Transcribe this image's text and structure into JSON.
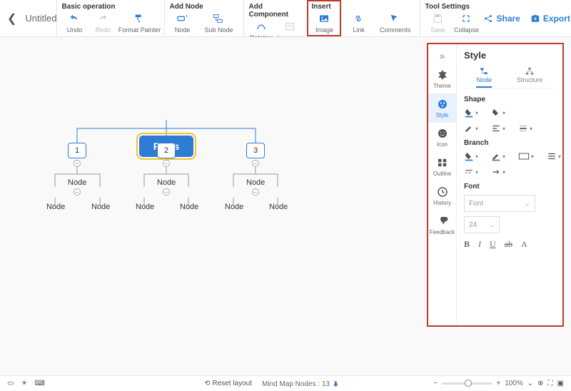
{
  "title": "Untitled",
  "toolbar": {
    "groups": {
      "basic": {
        "title": "Basic operation",
        "undo": "Undo",
        "redo": "Redo",
        "format_painter": "Format Painter"
      },
      "add_node": {
        "title": "Add Node",
        "node": "Node",
        "sub_node": "Sub Node"
      },
      "add_component": {
        "title": "Add Component",
        "relation": "Relation",
        "summary": "Summary"
      },
      "insert": {
        "title": "Insert",
        "image": "Image",
        "link": "Link",
        "comments": "Comments"
      },
      "tool_settings": {
        "title": "Tool Settings",
        "save": "Save",
        "collapse": "Collapse"
      }
    },
    "share": "Share",
    "export": "Export"
  },
  "mindmap": {
    "root": "Facts",
    "level1": [
      "1",
      "2",
      "3"
    ],
    "level2_label": "Node",
    "leaf_label": "Node"
  },
  "panel": {
    "title": "Style",
    "strip": {
      "theme": "Theme",
      "style": "Style",
      "icon": "Icon",
      "outline": "Outline",
      "history": "History",
      "feedback": "Feedback"
    },
    "tabs": {
      "node": "Node",
      "structure": "Structure"
    },
    "sections": {
      "shape": "Shape",
      "branch": "Branch",
      "font": "Font"
    },
    "font_placeholder": "Font",
    "font_size": "24",
    "font_buttons": {
      "bold": "B",
      "italic": "I",
      "underline": "U",
      "strike": "ab",
      "color": "A"
    }
  },
  "statusbar": {
    "reset": "Reset layout",
    "nodes_label": "Mind Map Nodes :",
    "nodes_count": "13",
    "zoom": "100%"
  },
  "colors": {
    "accent": "#2e7cd6",
    "highlight": "#c0392b"
  }
}
